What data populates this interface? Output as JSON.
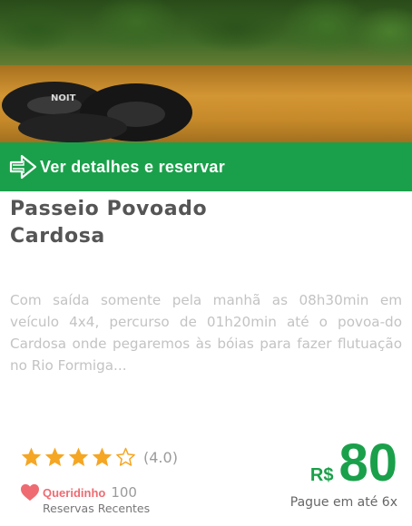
{
  "card": {
    "image_alt": "Boias no Rio Formiga",
    "cta_label": "Ver detalhes e reservar",
    "cta_icon": "arrow-right-icon",
    "title_line1": "Passeio Povoado",
    "title_line2": "Cardosa",
    "description": "Com saída somente pela manhã as 08h30min em veículo 4x4, percurso de 01h20min até o povoa-do Cardosa onde pegaremos às bóias para fazer flutuação no Rio Formiga...",
    "rating": {
      "stars_filled": 4,
      "stars_total": 5,
      "value_text": "(4.0)",
      "star_color": "#f5a623",
      "icon": "star-icon"
    },
    "favorite": {
      "label": "Queridinho",
      "count": "100",
      "icon": "heart-icon",
      "color": "#ee6b72",
      "recent_text": "Reservas Recentes"
    },
    "price": {
      "currency": "R$",
      "amount": "80",
      "installments": "Pague em até 6x",
      "color": "#1aa04a"
    }
  }
}
